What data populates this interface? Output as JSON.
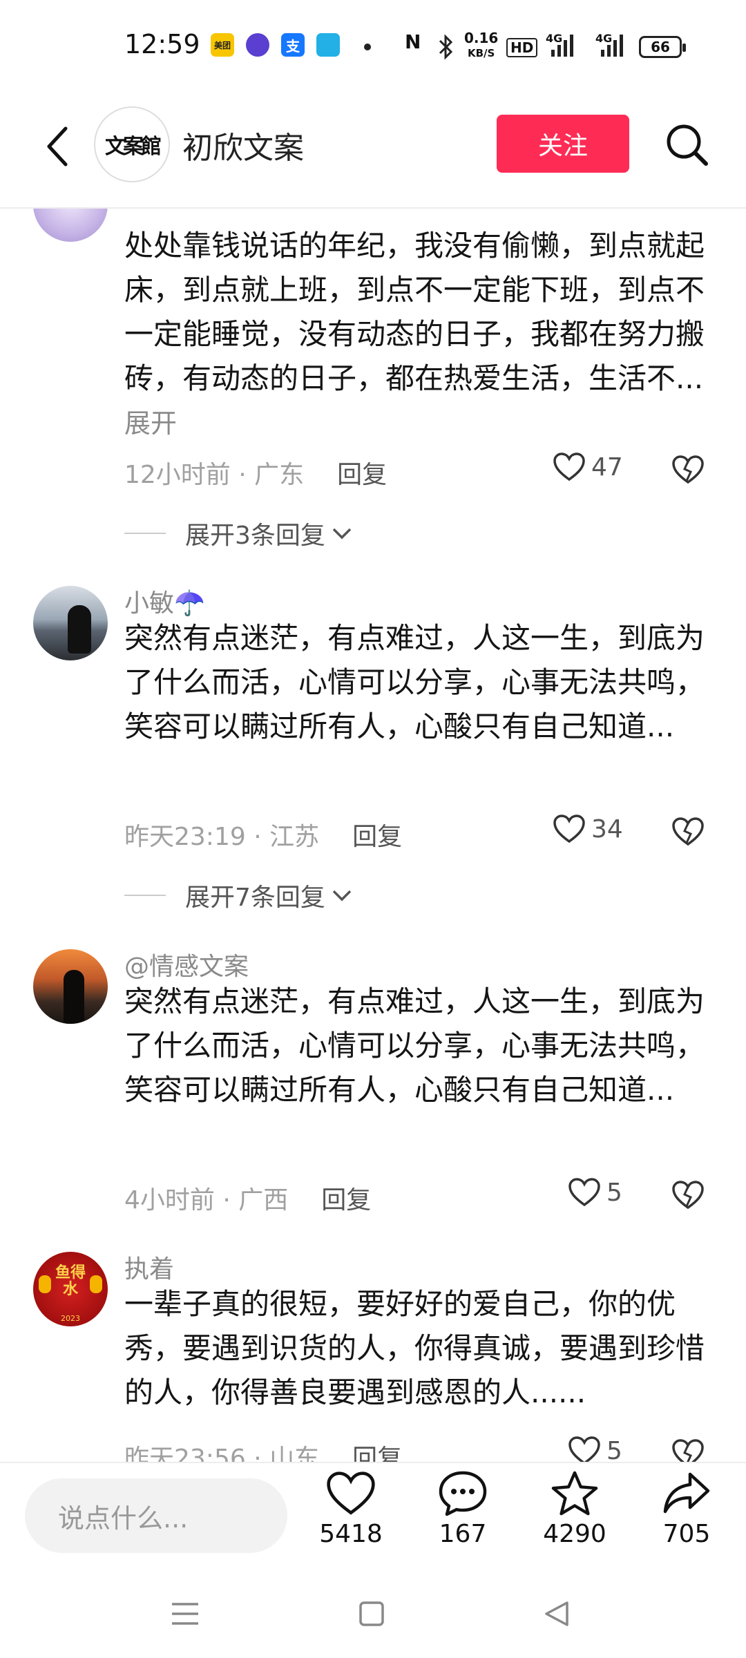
{
  "status_bar": {
    "time": "12:59",
    "apps": [
      "美团",
      "支"
    ],
    "network_speed_value": "0.16",
    "network_speed_unit": "KB/S",
    "hd_label": "HD",
    "signal_label": "4G",
    "battery": "66"
  },
  "header": {
    "logo_text": "文案館",
    "channel_name": "初欣文案",
    "follow_label": "关注"
  },
  "comments": [
    {
      "username": "",
      "text": "处处靠钱说话的年纪，我没有偷懒，到点就起床，到点就上班，到点不一定能下班，到点不一定能睡觉，没有动态的日子，我都在努力搬砖，有动态的日子，都在热爱生活，生活不...",
      "expand_label": "展开",
      "meta": "12小时前 · 广东",
      "reply_label": "回复",
      "likes": "47",
      "replies_expand": "展开3条回复"
    },
    {
      "username": "小敏☂️",
      "text": "突然有点迷茫，有点难过，人这一生，到底为了什么而活，心情可以分享，心事无法共鸣，笑容可以瞒过所有人，心酸只有自己知道...",
      "meta": "昨天23:19 · 江苏",
      "reply_label": "回复",
      "likes": "34",
      "replies_expand": "展开7条回复"
    },
    {
      "username": "@情感文案",
      "text": "突然有点迷茫，有点难过，人这一生，到底为了什么而活，心情可以分享，心事无法共鸣，笑容可以瞒过所有人，心酸只有自己知道...",
      "meta": "4小时前 · 广西",
      "reply_label": "回复",
      "likes": "5"
    },
    {
      "username": "执着",
      "avatar_text": "鱼得水",
      "avatar_year": "2023",
      "text": "一辈子真的很短，要好好的爱自己，你的优秀，要遇到识货的人，你得真诚，要遇到珍惜的人，你得善良要遇到感恩的人......",
      "meta": "昨天23:56 · 山东",
      "reply_label": "回复",
      "likes": "5"
    }
  ],
  "bottom_bar": {
    "input_placeholder": "说点什么...",
    "like_count": "5418",
    "comment_count": "167",
    "favorite_count": "4290",
    "share_count": "705"
  },
  "colors": {
    "accent": "#fe2c55",
    "muted_text": "#8a8a8a"
  }
}
